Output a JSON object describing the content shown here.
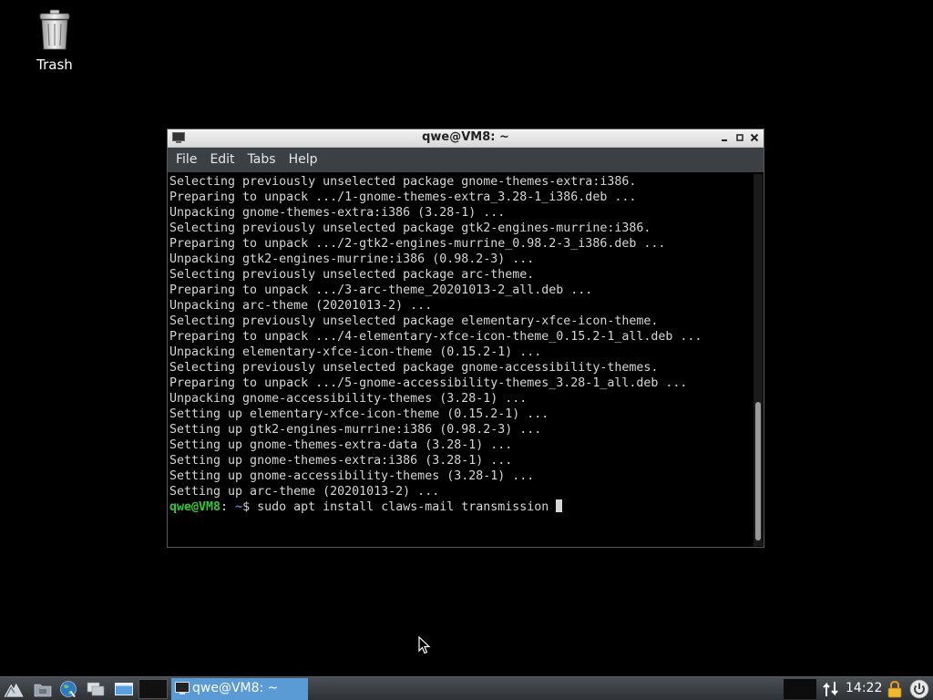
{
  "desktop": {
    "icons": [
      {
        "label": "Trash",
        "icon": "trash-icon"
      }
    ]
  },
  "terminal": {
    "title": "qwe@VM8: ~",
    "menu": [
      "File",
      "Edit",
      "Tabs",
      "Help"
    ],
    "output_lines": [
      "Selecting previously unselected package gnome-themes-extra:i386.",
      "Preparing to unpack .../1-gnome-themes-extra_3.28-1_i386.deb ...",
      "Unpacking gnome-themes-extra:i386 (3.28-1) ...",
      "Selecting previously unselected package gtk2-engines-murrine:i386.",
      "Preparing to unpack .../2-gtk2-engines-murrine_0.98.2-3_i386.deb ...",
      "Unpacking gtk2-engines-murrine:i386 (0.98.2-3) ...",
      "Selecting previously unselected package arc-theme.",
      "Preparing to unpack .../3-arc-theme_20201013-2_all.deb ...",
      "Unpacking arc-theme (20201013-2) ...",
      "Selecting previously unselected package elementary-xfce-icon-theme.",
      "Preparing to unpack .../4-elementary-xfce-icon-theme_0.15.2-1_all.deb ...",
      "Unpacking elementary-xfce-icon-theme (0.15.2-1) ...",
      "Selecting previously unselected package gnome-accessibility-themes.",
      "Preparing to unpack .../5-gnome-accessibility-themes_3.28-1_all.deb ...",
      "Unpacking gnome-accessibility-themes (3.28-1) ...",
      "Setting up elementary-xfce-icon-theme (0.15.2-1) ...",
      "Setting up gtk2-engines-murrine:i386 (0.98.2-3) ...",
      "Setting up gnome-themes-extra-data (3.28-1) ...",
      "Setting up gnome-themes-extra:i386 (3.28-1) ...",
      "Setting up gnome-accessibility-themes (3.28-1) ...",
      "Setting up arc-theme (20201013-2) ..."
    ],
    "prompt": {
      "user_host": "qwe@VM8",
      "separator": ":",
      "path": " ~",
      "symbol": "$",
      "command": " sudo apt install claws-mail transmission "
    },
    "colors": {
      "prompt_user": "#34c734",
      "prompt_path": "#5d7fe0",
      "text": "#d6d6d6",
      "menubar": "#3b4045"
    }
  },
  "taskbar": {
    "launchers": [
      "start-menu-icon",
      "file-manager-icon",
      "web-browser-icon",
      "show-desktop-icon",
      "window-icon"
    ],
    "task": {
      "label": "qwe@VM8: ~"
    },
    "clock": "14:22",
    "accent": "#5b9bd5"
  }
}
